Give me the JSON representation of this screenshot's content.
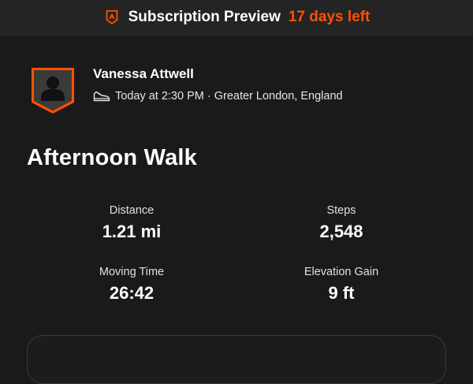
{
  "banner": {
    "title": "Subscription Preview",
    "days_left": "17 days left",
    "logo_icon": "strava-logo-icon",
    "accent_color": "#fc5200"
  },
  "athlete": {
    "name": "Vanessa Attwell",
    "avatar_icon": "avatar-placeholder-icon",
    "activity_icon": "shoe-icon",
    "meta": "Today at 2:30 PM · Greater London, England"
  },
  "activity": {
    "title": "Afternoon Walk"
  },
  "stats": {
    "distance": {
      "label": "Distance",
      "value": "1.21 mi"
    },
    "steps": {
      "label": "Steps",
      "value": "2,548"
    },
    "moving_time": {
      "label": "Moving Time",
      "value": "26:42"
    },
    "elevation_gain": {
      "label": "Elevation Gain",
      "value": "9 ft"
    }
  }
}
